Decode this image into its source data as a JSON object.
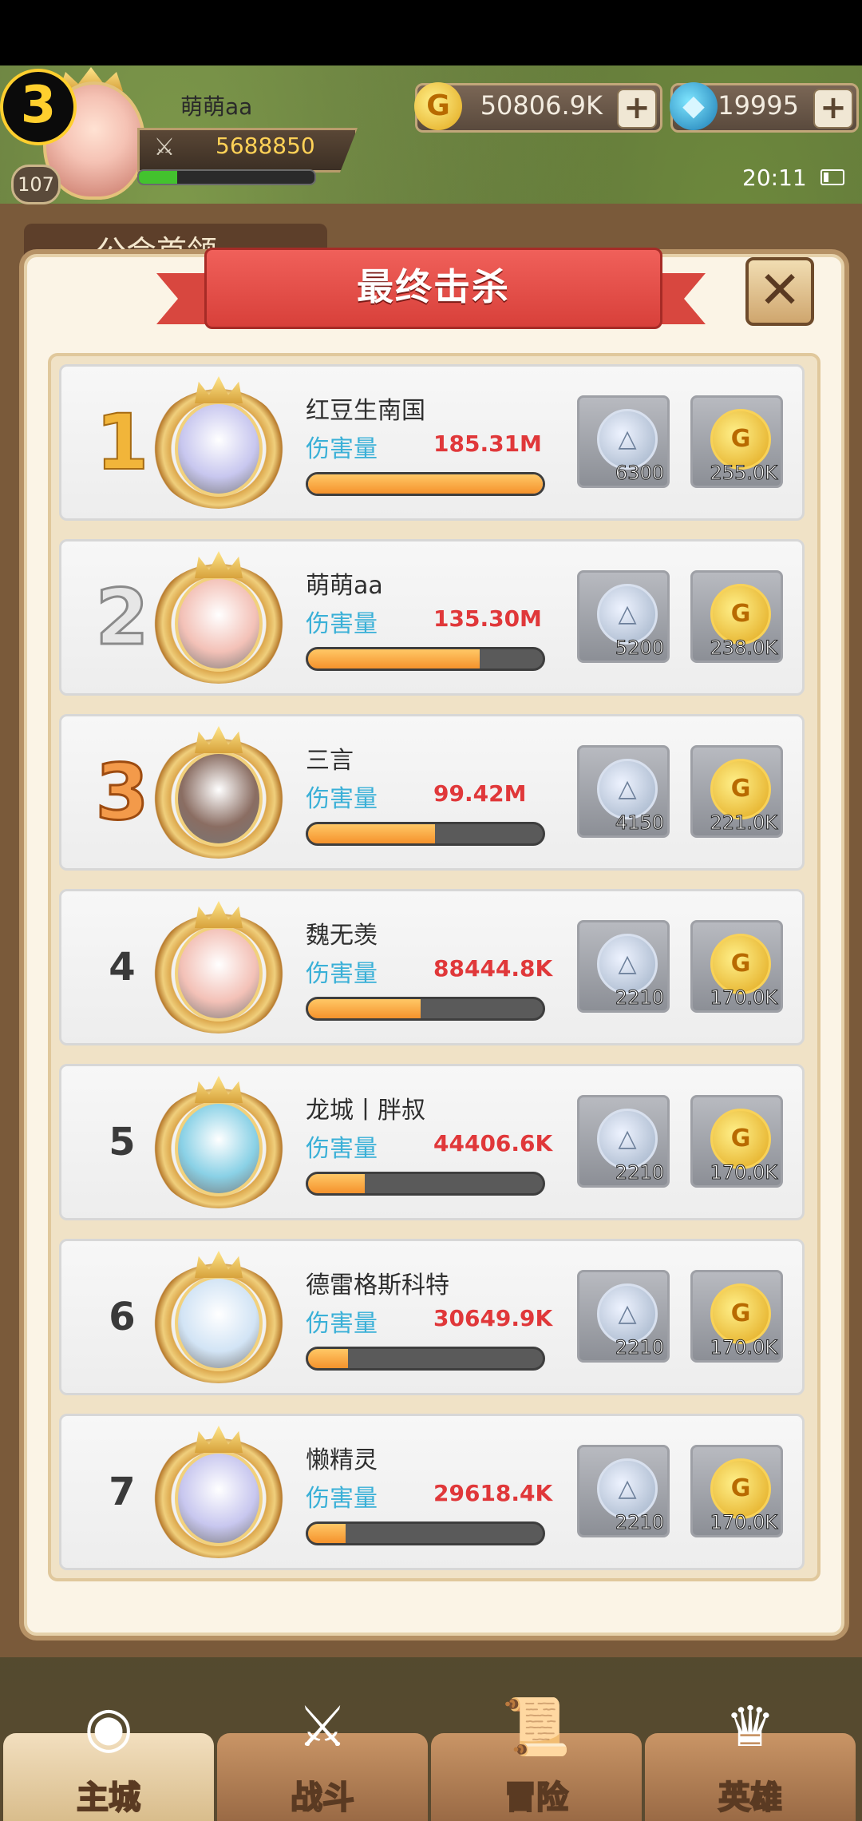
{
  "hud": {
    "vip_level": "3",
    "player_level": "107",
    "player_name": "萌萌aa",
    "power": "5688850",
    "exp_fraction": 0.22,
    "gold": "50806.9K",
    "gems": "19995",
    "plus": "+",
    "time": "20:11",
    "behind_text": "公会首领"
  },
  "dialog": {
    "title": "最终击杀",
    "close": "✕",
    "damage_label": "伤害量"
  },
  "rows": [
    {
      "rank": "1",
      "name": "红豆生南国",
      "damage": "185.31M",
      "progress": 1.0,
      "silver": "6300",
      "gold": "255.0K",
      "face": "#c8c7ef"
    },
    {
      "rank": "2",
      "name": "萌萌aa",
      "damage": "135.30M",
      "progress": 0.73,
      "silver": "5200",
      "gold": "238.0K",
      "face": "#f3c1b7"
    },
    {
      "rank": "3",
      "name": "三言",
      "damage": "99.42M",
      "progress": 0.54,
      "silver": "4150",
      "gold": "221.0K",
      "face": "#8a6d62"
    },
    {
      "rank": "4",
      "name": "魏无羡",
      "damage": "88444.8K",
      "progress": 0.48,
      "silver": "2210",
      "gold": "170.0K",
      "face": "#f3c1b7"
    },
    {
      "rank": "5",
      "name": "龙城丨胖叔",
      "damage": "44406.6K",
      "progress": 0.24,
      "silver": "2210",
      "gold": "170.0K",
      "face": "#8ad1e6"
    },
    {
      "rank": "6",
      "name": "德雷格斯科特",
      "damage": "30649.9K",
      "progress": 0.17,
      "silver": "2210",
      "gold": "170.0K",
      "face": "#d2e4f5"
    },
    {
      "rank": "7",
      "name": "懒精灵",
      "damage": "29618.4K",
      "progress": 0.16,
      "silver": "2210",
      "gold": "170.0K",
      "face": "#c8c7ef"
    }
  ],
  "coins": {
    "silver_glyph": "△",
    "gold_glyph": "G"
  },
  "nav": [
    {
      "label": "主城",
      "icon": "castle-icon",
      "glyph": "◉",
      "active": true
    },
    {
      "label": "战斗",
      "icon": "crossed-swords-icon",
      "glyph": "⚔",
      "active": false
    },
    {
      "label": "冒险",
      "icon": "scroll-map-icon",
      "glyph": "📜",
      "active": false
    },
    {
      "label": "英雄",
      "icon": "helmet-icon",
      "glyph": "♛",
      "active": false
    }
  ],
  "colors": {
    "damage_value": "#e0383a",
    "damage_label": "#3ab0d7",
    "bar_fill": "#f5922c",
    "banner": "#d8473f"
  }
}
